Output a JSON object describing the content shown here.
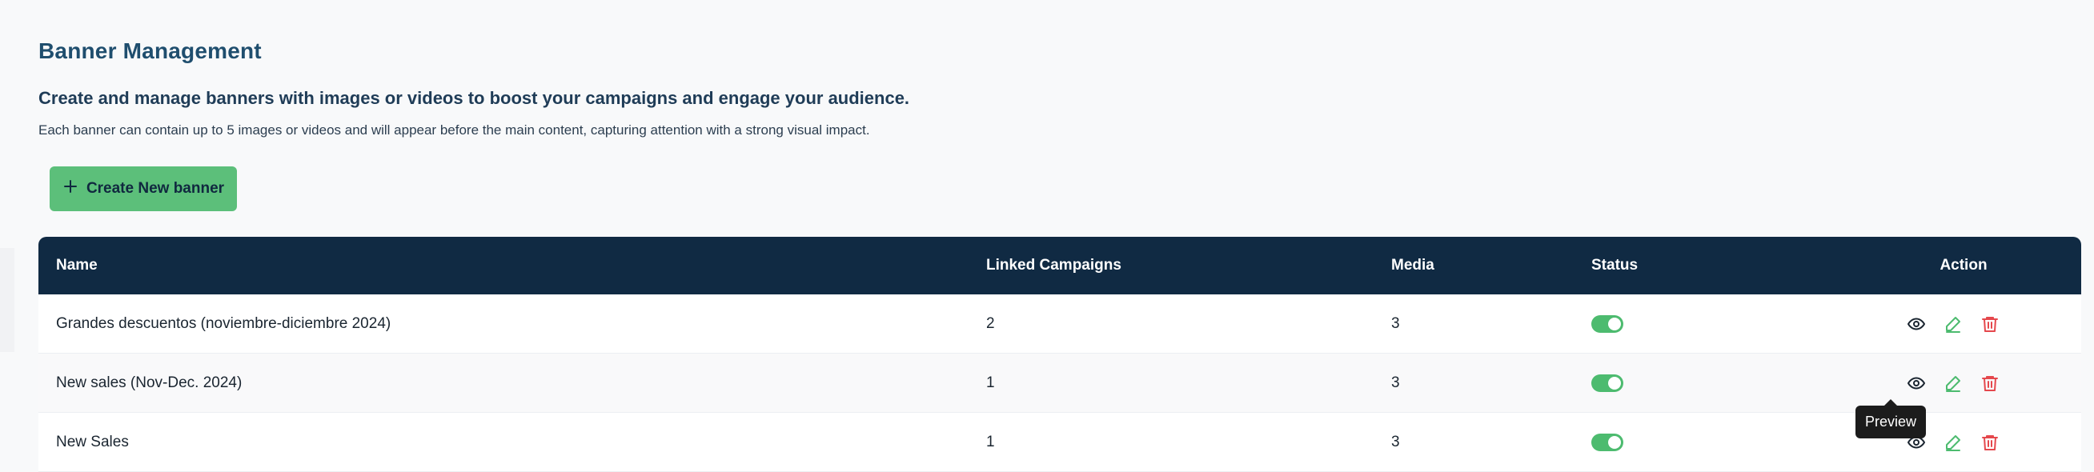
{
  "page": {
    "title": "Banner Management",
    "headline": "Create and manage banners with images or videos to boost your campaigns and engage your audience.",
    "description": "Each banner can contain up to 5 images or videos and will appear before the main content, capturing attention with a strong visual impact.",
    "create_button_label": "Create New banner"
  },
  "table": {
    "columns": {
      "name": "Name",
      "linked": "Linked Campaigns",
      "media": "Media",
      "status": "Status",
      "action": "Action"
    },
    "rows": [
      {
        "name": "Grandes descuentos (noviembre-diciembre 2024)",
        "linked": "2",
        "media": "3",
        "status_on": true
      },
      {
        "name": "New sales (Nov-Dec. 2024)",
        "linked": "1",
        "media": "3",
        "status_on": true
      },
      {
        "name": "New Sales",
        "linked": "1",
        "media": "3",
        "status_on": true
      }
    ]
  },
  "tooltip": {
    "text": "Preview"
  },
  "colors": {
    "accent_green": "#5cbf7a",
    "header_navy": "#102a43",
    "edit_green": "#4dbb6f",
    "delete_red": "#e5484d"
  },
  "icons": [
    "plus-icon",
    "eye-icon",
    "pencil-icon",
    "trash-icon"
  ]
}
